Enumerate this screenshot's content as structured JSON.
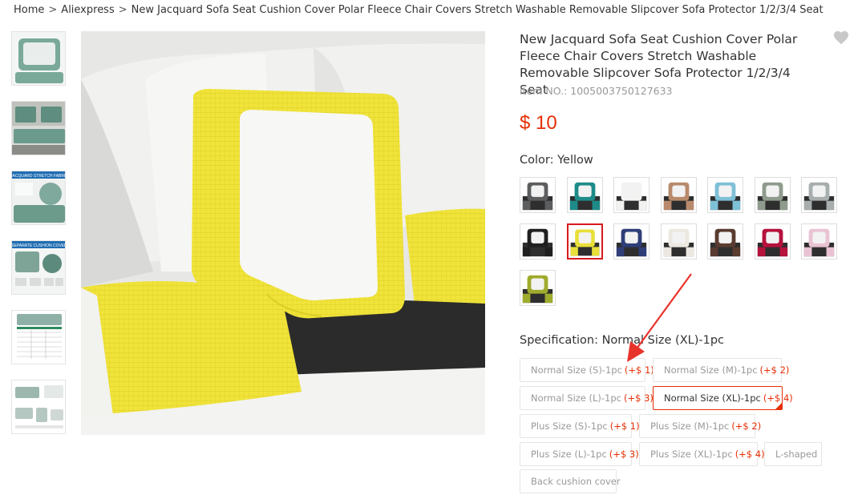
{
  "breadcrumb": {
    "home": "Home",
    "store": "Aliexpress",
    "current": "New Jacquard Sofa Seat Cushion Cover Polar Fleece Chair Covers Stretch Washable Removable Slipcover Sofa Protector 1/2/3/4 Seat",
    "separator": ">"
  },
  "thumbnails": [
    {
      "name": "thumb-green-cover"
    },
    {
      "name": "thumb-sofa-green"
    },
    {
      "name": "thumb-jacquard-stretch",
      "caption": "JACQUARD STRETCH FABRIC"
    },
    {
      "name": "thumb-separate-cushion",
      "caption": "SEPARATE CUSHION COVER"
    },
    {
      "name": "thumb-size-table"
    },
    {
      "name": "thumb-shapes"
    }
  ],
  "product": {
    "title": "New Jacquard Sofa Seat Cushion Cover Polar Fleece Chair Covers Stretch Washable Removable Slipcover Sofa Protector 1/2/3/4 Seat",
    "item_no": "Item NO.: 1005003750127633",
    "price": "$ 10",
    "wish_icon": "heart-icon"
  },
  "color": {
    "label": "Color: Yellow",
    "swatches": [
      {
        "color": "#5c5d5f",
        "seat": "#2e2e2e"
      },
      {
        "color": "#1e8b89",
        "seat": "#2e2e2e"
      },
      {
        "color": "#f2f2f0",
        "seat": "#2e2e2e"
      },
      {
        "color": "#b88a6b",
        "seat": "#2e2e2e"
      },
      {
        "color": "#7ec0d6",
        "seat": "#2e2e2e"
      },
      {
        "color": "#8f9b8d",
        "seat": "#2e2e2e"
      },
      {
        "color": "#a8adad",
        "seat": "#2e2e2e"
      },
      {
        "color": "#1f1f20",
        "seat": "#2e2e2e"
      },
      {
        "color": "#e8df3a",
        "seat": "#2e2e2e",
        "selected": true
      },
      {
        "color": "#2f3e78",
        "seat": "#2e2e2e"
      },
      {
        "color": "#ece8e1",
        "seat": "#2e2e2e"
      },
      {
        "color": "#5a3b30",
        "seat": "#2e2e2e"
      },
      {
        "color": "#b5123c",
        "seat": "#2e2e2e"
      },
      {
        "color": "#e9c3d3",
        "seat": "#2e2e2e"
      },
      {
        "color": "#9fab2d",
        "seat": "#2e2e2e"
      }
    ]
  },
  "specification": {
    "label": "Specification: Normal Size (XL)-1pc",
    "options": [
      {
        "label": "Normal Size (S)-1pc",
        "add": "(+$ 1)"
      },
      {
        "label": "Normal Size (M)-1pc",
        "add": "(+$ 2)"
      },
      {
        "label": "Normal Size (L)-1pc",
        "add": "(+$ 3)"
      },
      {
        "label": "Normal Size (XL)-1pc",
        "add": "(+$ 4)",
        "selected": true
      },
      {
        "label": "Plus Size (S)-1pc",
        "add": "(+$ 1)"
      },
      {
        "label": "Plus Size (M)-1pc",
        "add": "(+$ 2)"
      },
      {
        "label": "Plus Size (L)-1pc",
        "add": "(+$ 3)"
      },
      {
        "label": "Plus Size (XL)-1pc",
        "add": "(+$ 4)"
      },
      {
        "label": "L-shaped",
        "add": ""
      },
      {
        "label": "Back cushion cover",
        "add": ""
      }
    ]
  },
  "colors": {
    "price": "#e62e04",
    "selected_border": "#d71920",
    "annotation_arrow": "#e8332b"
  }
}
